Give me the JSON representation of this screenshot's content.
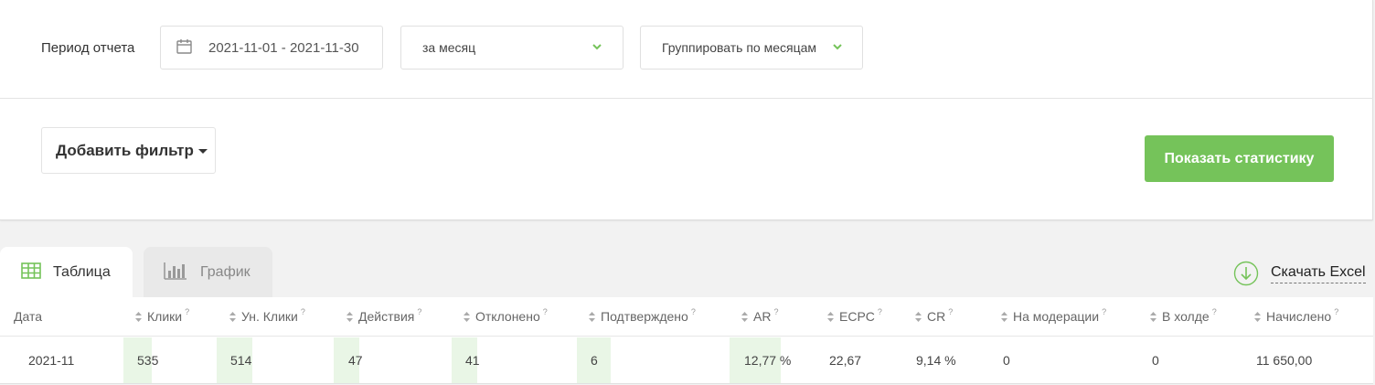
{
  "filters": {
    "period_label": "Период отчета",
    "date_range": "2021-11-01 - 2021-11-30",
    "period_select": "за месяц",
    "group_select": "Группировать по месяцам",
    "add_filter": "Добавить фильтр",
    "show_button": "Показать статистику"
  },
  "tabs": [
    {
      "label": "Таблица",
      "active": true
    },
    {
      "label": "График",
      "active": false
    }
  ],
  "download_label": "Скачать Excel",
  "colors": {
    "accent": "#75c35a",
    "bar": "#e9f6e6"
  },
  "table": {
    "columns": [
      {
        "label": "Дата",
        "hint": ""
      },
      {
        "label": "Клики",
        "hint": "?"
      },
      {
        "label": "Ун. Клики",
        "hint": "?"
      },
      {
        "label": "Действия",
        "hint": "?"
      },
      {
        "label": "Отклонено",
        "hint": "?"
      },
      {
        "label": "Подтверждено",
        "hint": "?"
      },
      {
        "label": "AR",
        "hint": "?"
      },
      {
        "label": "ECPC",
        "hint": "?"
      },
      {
        "label": "CR",
        "hint": "?"
      },
      {
        "label": "На модерации",
        "hint": "?"
      },
      {
        "label": "В холде",
        "hint": "?"
      },
      {
        "label": "Начислено",
        "hint": "?"
      }
    ],
    "rows": [
      {
        "cells": [
          "2021-11",
          "535",
          "514",
          "47",
          "41",
          "6",
          "12,77 %",
          "22,67",
          "9,14 %",
          "0",
          "0",
          "11 650,00"
        ]
      }
    ]
  }
}
